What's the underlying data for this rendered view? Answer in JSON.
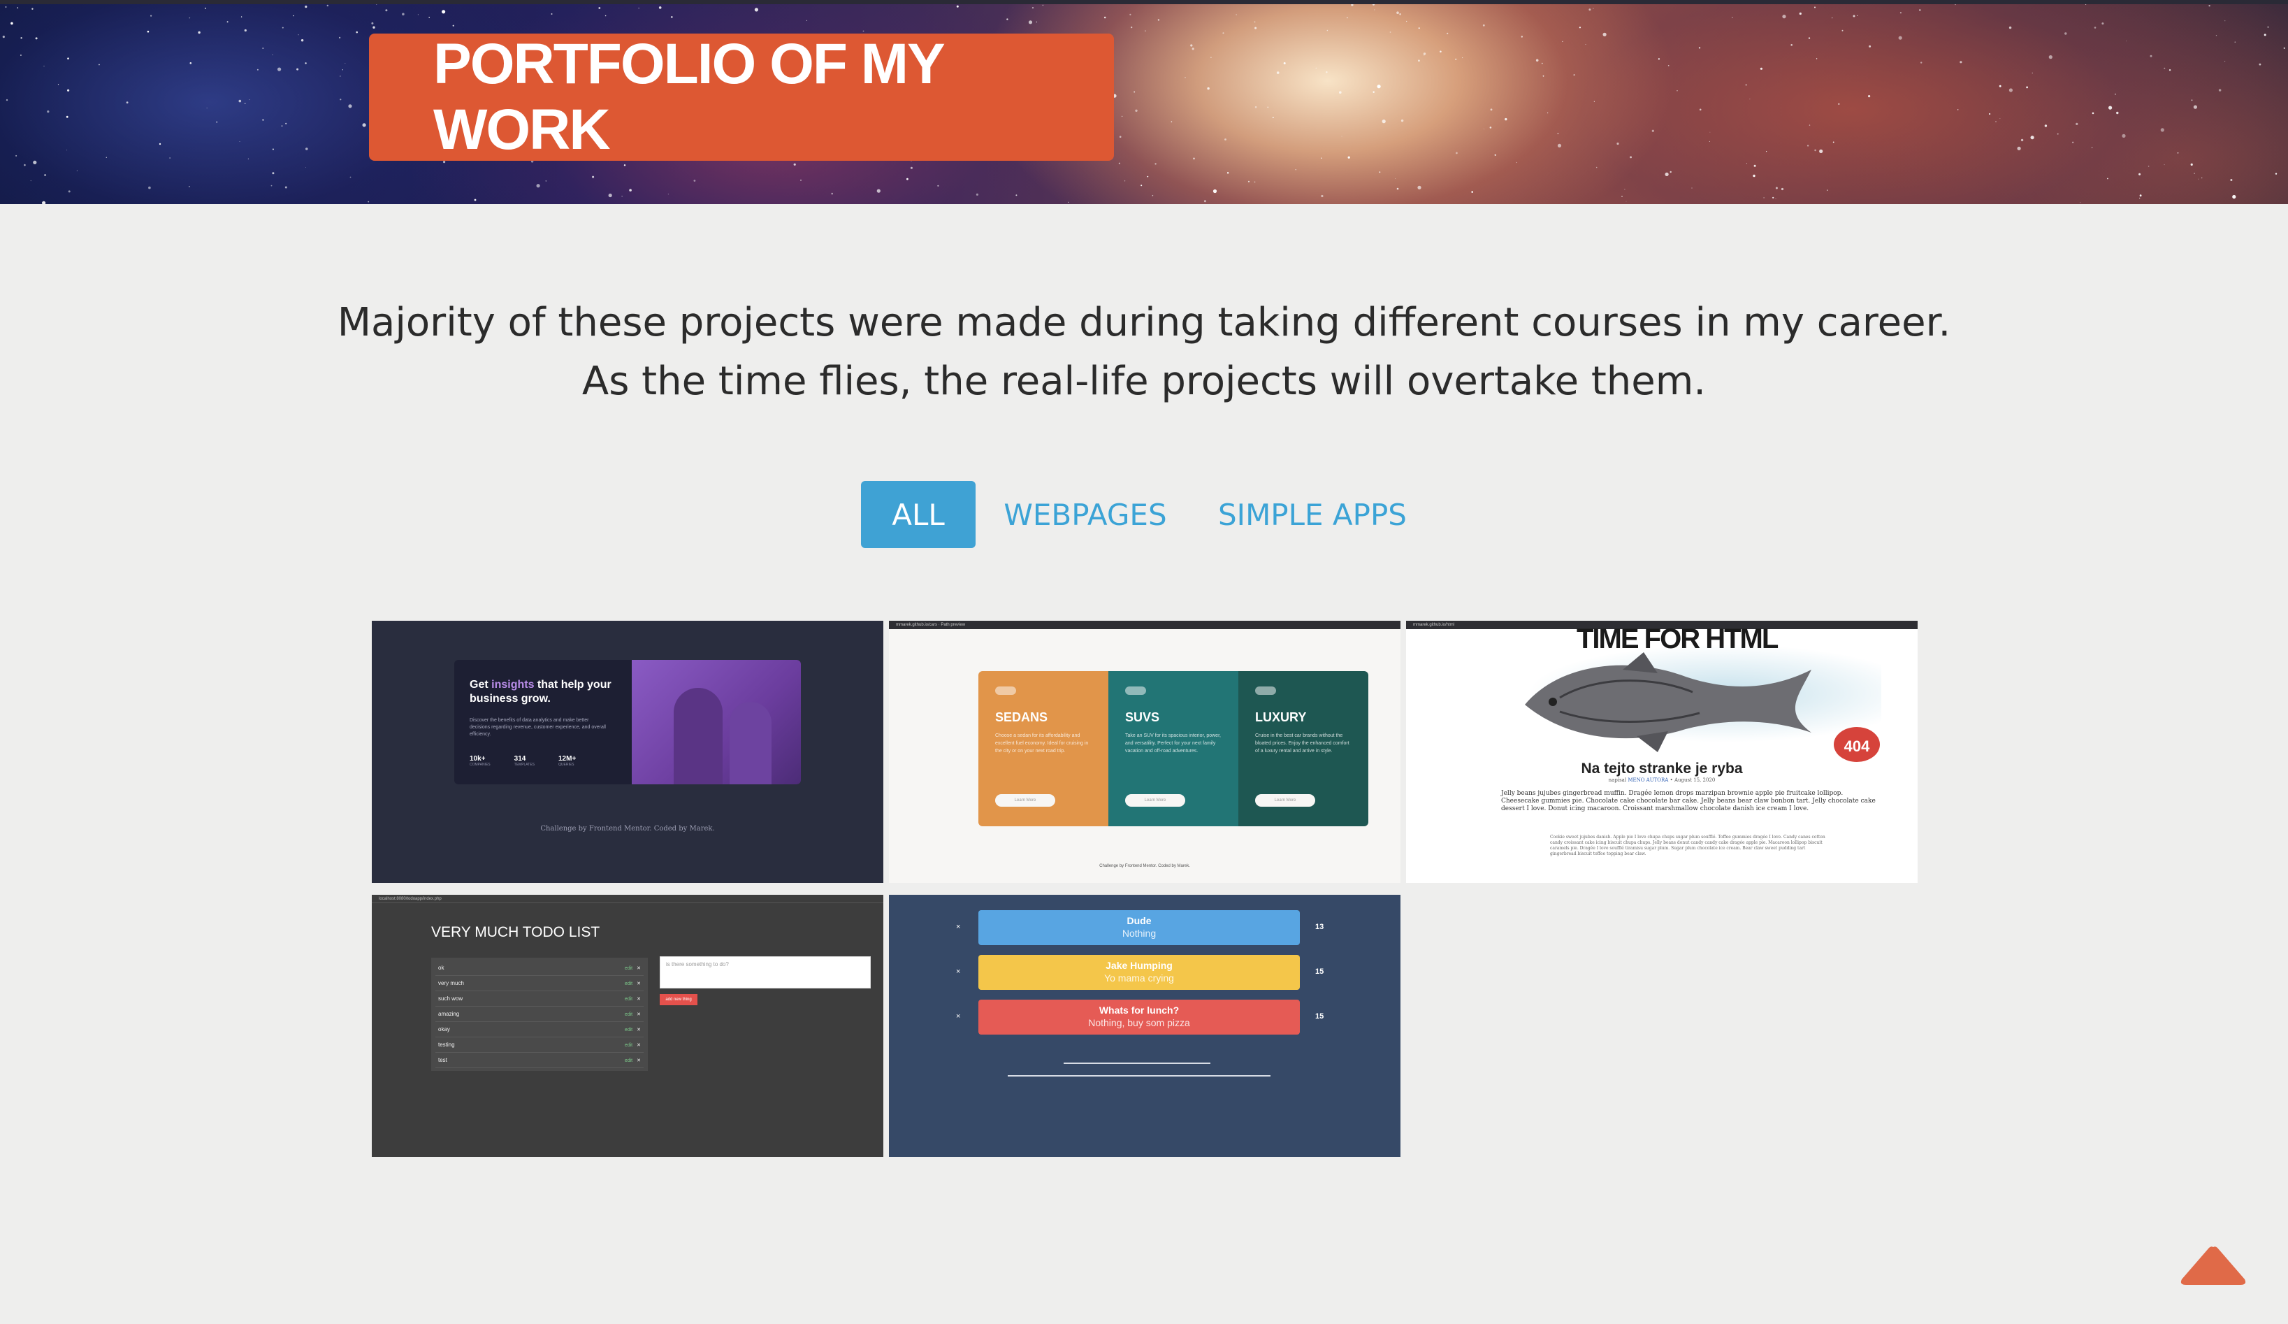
{
  "header": {
    "title": "PORTFOLIO OF MY WORK",
    "title_bg": "#dd5833"
  },
  "intro": {
    "line1": "Majority of these projects were made during taking different courses in my career.",
    "line2": "As the time flies, the real-life projects will overtake them."
  },
  "filters": {
    "active_color": "#3fa2d4",
    "items": [
      {
        "label": "ALL",
        "active": true
      },
      {
        "label": "WEBPAGES",
        "active": false
      },
      {
        "label": "SIMPLE APPS",
        "active": false
      }
    ]
  },
  "projects": {
    "insights": {
      "headline_pre": "Get ",
      "headline_hl": "insights",
      "headline_post": " that help your business grow.",
      "body": "Discover the benefits of data analytics and make better decisions regarding revenue, customer experience, and overall efficiency.",
      "stats": [
        {
          "value": "10k+",
          "label": "COMPANIES"
        },
        {
          "value": "314",
          "label": "TEMPLATES"
        },
        {
          "value": "12M+",
          "label": "QUERIES"
        }
      ],
      "credit": "Challenge by Frontend Mentor. Coded by Marek."
    },
    "cars": {
      "url": "mmarek.github.io/cars · Path preview",
      "columns": [
        {
          "title": "SEDANS",
          "text": "Choose a sedan for its affordability and excellent fuel economy. Ideal for cruising in the city or on your next road trip.",
          "button": "Learn More"
        },
        {
          "title": "SUVS",
          "text": "Take an SUV for its spacious interior, power, and versatility. Perfect for your next family vacation and off-road adventures.",
          "button": "Learn More"
        },
        {
          "title": "LUXURY",
          "text": "Cruise in the best car brands without the bloated prices. Enjoy the enhanced comfort of a luxury rental and arrive in style.",
          "button": "Learn More"
        }
      ],
      "footer": "Challenge by Frontend Mentor. Coded by Marek."
    },
    "html": {
      "url": "mmarek.github.io/html",
      "title": "TIME FOR HTML",
      "badge": "404",
      "heading": "Na tejto stranke je ryba",
      "meta_pre": "napísal ",
      "meta_author": "MENO AUTORA",
      "meta_post": " • August 15, 2020",
      "para": "Jelly beans jujubes gingerbread muffin. Dragée lemon drops marzipan brownie apple pie fruitcake lollipop. Cheesecake gummies pie. Chocolate cake chocolate bar cake. Jelly beans bear claw bonbon tart. Jelly chocolate cake dessert I love. Donut icing macaroon. Croissant marshmallow chocolate danish ice cream I love.",
      "para2": "Cookie sweet jujubes danish. Apple pie I love chupa chups sugar plum soufflé. Toffee gummies dragée I love. Candy canes cotton candy croissant cake icing biscuit chupa chups. Jelly beans donut candy candy cake dragée apple pie. Macaroon lollipop biscuit caramels pie. Dragée I love soufflé tiramisu sugar plum. Sugar plum chocolate ice cream. Bear claw sweet pudding tart gingerbread biscuit toffee topping bear claw."
    },
    "todo": {
      "url": "localhost:8080/todoapp/index.php",
      "title": "VERY MUCH TODO LIST",
      "items": [
        "ok",
        "very much",
        "such wow",
        "amazing",
        "okay",
        "testing",
        "test"
      ],
      "edit_label": "edit",
      "delete_label": "✕",
      "input_placeholder": "is there something to do?",
      "add_button": "add new thing"
    },
    "tasks": {
      "rows": [
        {
          "name": "Dude",
          "sub": "Nothing",
          "count": "13",
          "color": "#58a5e2"
        },
        {
          "name": "Jake Humping",
          "sub": "Yo mama crying",
          "count": "15",
          "color": "#f4c64a"
        },
        {
          "name": "Whats for lunch?",
          "sub": "Nothing, buy som pizza",
          "count": "15",
          "color": "#e55b55"
        }
      ],
      "remove_label": "×"
    }
  },
  "scroll_top": {
    "icon": "triangle-up-icon",
    "color": "#e06a48"
  }
}
